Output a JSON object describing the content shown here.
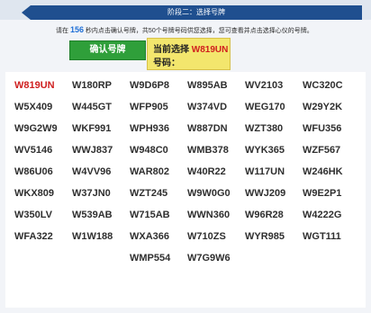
{
  "stepbar": {
    "label": "阶段二：选择号牌"
  },
  "instruction": {
    "prefix": "请在",
    "count": "156",
    "suffix": "秒内点击确认号牌，共50个号牌号码供您选择，您可查看并点击选择心仪的号牌。"
  },
  "confirm_button": {
    "label": "确认号牌"
  },
  "current_selection": {
    "label": "当前选择",
    "value": "W819UN",
    "sub": "号码："
  },
  "plates": [
    "W819UN",
    "W180RP",
    "W9D6P8",
    "W895AB",
    "WV2103",
    "WC320C",
    "W5X409",
    "W445GT",
    "WFP905",
    "W374VD",
    "WEG170",
    "W29Y2K",
    "W9G2W9",
    "WKF991",
    "WPH936",
    "W887DN",
    "WZT380",
    "WFU356",
    "WV5146",
    "WWJ837",
    "W948C0",
    "WMB378",
    "WYK365",
    "WZF567",
    "W86U06",
    "W4VV96",
    "WAR802",
    "W40R22",
    "W117UN",
    "W246HK",
    "WKX809",
    "W37JN0",
    "WZT245",
    "W9W0G0",
    "WWJ209",
    "W9E2P1",
    "W350LV",
    "W539AB",
    "W715AB",
    "WWN360",
    "W96R28",
    "W4222G",
    "WFA322",
    "W1W188",
    "WXA366",
    "W710ZS",
    "WYR985",
    "WGT111",
    "",
    "",
    "WMP554",
    "W7G9W6",
    "",
    ""
  ],
  "colors": {
    "accent": "#1f4f8f",
    "confirm": "#2f9f3a",
    "highlight": "#f3e66d",
    "selected_text": "#cf1f1f"
  }
}
